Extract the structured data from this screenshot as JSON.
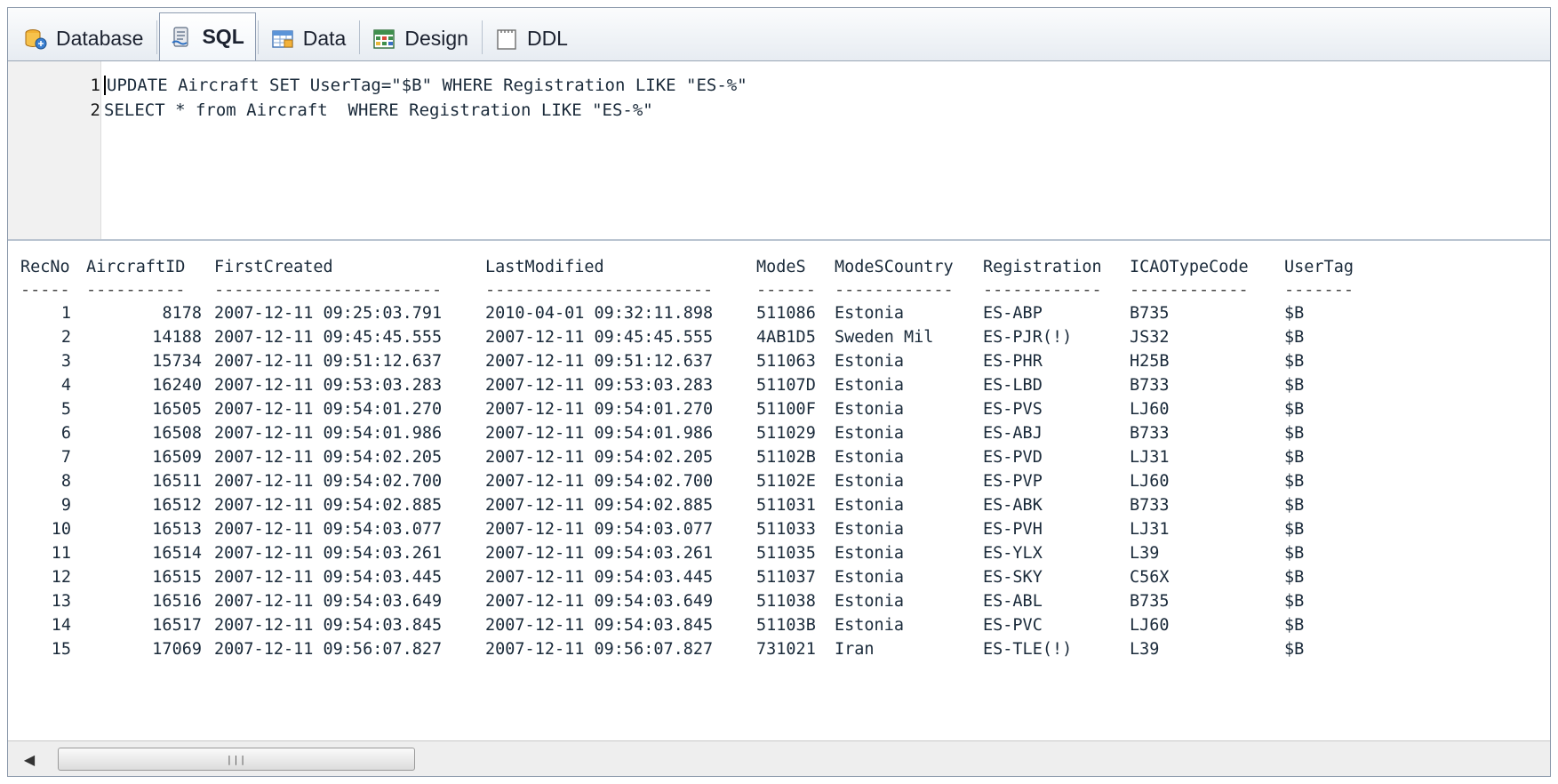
{
  "tabs": [
    {
      "label": "Database",
      "icon": "database-icon",
      "active": false
    },
    {
      "label": "SQL",
      "icon": "sql-scroll-icon",
      "active": true
    },
    {
      "label": "Data",
      "icon": "data-grid-icon",
      "active": false
    },
    {
      "label": "Design",
      "icon": "design-table-icon",
      "active": false
    },
    {
      "label": "DDL",
      "icon": "ddl-document-icon",
      "active": false
    }
  ],
  "editor": {
    "lines": [
      {
        "number": "1",
        "text": "UPDATE Aircraft SET UserTag=\"$B\" WHERE Registration LIKE \"ES-%\""
      },
      {
        "number": "2",
        "text": "SELECT * from Aircraft  WHERE Registration LIKE \"ES-%\""
      }
    ]
  },
  "results": {
    "columns": [
      "RecNo",
      "AircraftID",
      "FirstCreated",
      "LastModified",
      "ModeS",
      "ModeSCountry",
      "Registration",
      "ICAOTypeCode",
      "UserTag"
    ],
    "separators": [
      "-----",
      "----------",
      "-----------------------",
      "-----------------------",
      "------",
      "------------",
      "------------",
      "------------",
      "-------"
    ],
    "rows": [
      [
        "1",
        "8178",
        "2007-12-11 09:25:03.791",
        "2010-04-01 09:32:11.898",
        "511086",
        "Estonia",
        "ES-ABP",
        "B735",
        "$B"
      ],
      [
        "2",
        "14188",
        "2007-12-11 09:45:45.555",
        "2007-12-11 09:45:45.555",
        "4AB1D5",
        "Sweden Mil",
        "ES-PJR(!)",
        "JS32",
        "$B"
      ],
      [
        "3",
        "15734",
        "2007-12-11 09:51:12.637",
        "2007-12-11 09:51:12.637",
        "511063",
        "Estonia",
        "ES-PHR",
        "H25B",
        "$B"
      ],
      [
        "4",
        "16240",
        "2007-12-11 09:53:03.283",
        "2007-12-11 09:53:03.283",
        "51107D",
        "Estonia",
        "ES-LBD",
        "B733",
        "$B"
      ],
      [
        "5",
        "16505",
        "2007-12-11 09:54:01.270",
        "2007-12-11 09:54:01.270",
        "51100F",
        "Estonia",
        "ES-PVS",
        "LJ60",
        "$B"
      ],
      [
        "6",
        "16508",
        "2007-12-11 09:54:01.986",
        "2007-12-11 09:54:01.986",
        "511029",
        "Estonia",
        "ES-ABJ",
        "B733",
        "$B"
      ],
      [
        "7",
        "16509",
        "2007-12-11 09:54:02.205",
        "2007-12-11 09:54:02.205",
        "51102B",
        "Estonia",
        "ES-PVD",
        "LJ31",
        "$B"
      ],
      [
        "8",
        "16511",
        "2007-12-11 09:54:02.700",
        "2007-12-11 09:54:02.700",
        "51102E",
        "Estonia",
        "ES-PVP",
        "LJ60",
        "$B"
      ],
      [
        "9",
        "16512",
        "2007-12-11 09:54:02.885",
        "2007-12-11 09:54:02.885",
        "511031",
        "Estonia",
        "ES-ABK",
        "B733",
        "$B"
      ],
      [
        "10",
        "16513",
        "2007-12-11 09:54:03.077",
        "2007-12-11 09:54:03.077",
        "511033",
        "Estonia",
        "ES-PVH",
        "LJ31",
        "$B"
      ],
      [
        "11",
        "16514",
        "2007-12-11 09:54:03.261",
        "2007-12-11 09:54:03.261",
        "511035",
        "Estonia",
        "ES-YLX",
        "L39",
        "$B"
      ],
      [
        "12",
        "16515",
        "2007-12-11 09:54:03.445",
        "2007-12-11 09:54:03.445",
        "511037",
        "Estonia",
        "ES-SKY",
        "C56X",
        "$B"
      ],
      [
        "13",
        "16516",
        "2007-12-11 09:54:03.649",
        "2007-12-11 09:54:03.649",
        "511038",
        "Estonia",
        "ES-ABL",
        "B735",
        "$B"
      ],
      [
        "14",
        "16517",
        "2007-12-11 09:54:03.845",
        "2007-12-11 09:54:03.845",
        "51103B",
        "Estonia",
        "ES-PVC",
        "LJ60",
        "$B"
      ],
      [
        "15",
        "17069",
        "2007-12-11 09:56:07.827",
        "2007-12-11 09:56:07.827",
        "731021",
        "Iran",
        "ES-TLE(!)",
        "L39",
        "$B"
      ]
    ]
  },
  "scrollbar": {
    "left_arrow": "◀",
    "grip": "|||"
  }
}
